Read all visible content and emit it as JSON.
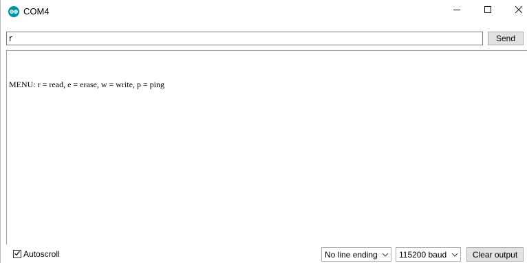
{
  "window": {
    "title": "COM4",
    "accent_color": "#00979c",
    "icon": "arduino-logo-icon",
    "controls": [
      "minimize-icon",
      "maximize-icon",
      "close-icon"
    ]
  },
  "send_row": {
    "input_value": "r",
    "send_label": "Send"
  },
  "output": {
    "lines": [
      "MENU: r = read, e = erase, w = write, p = ping"
    ]
  },
  "bottom_bar": {
    "autoscroll_label": "Autoscroll",
    "autoscroll_checked": true,
    "line_ending": "No line ending",
    "baud": "115200 baud",
    "clear_label": "Clear output"
  }
}
